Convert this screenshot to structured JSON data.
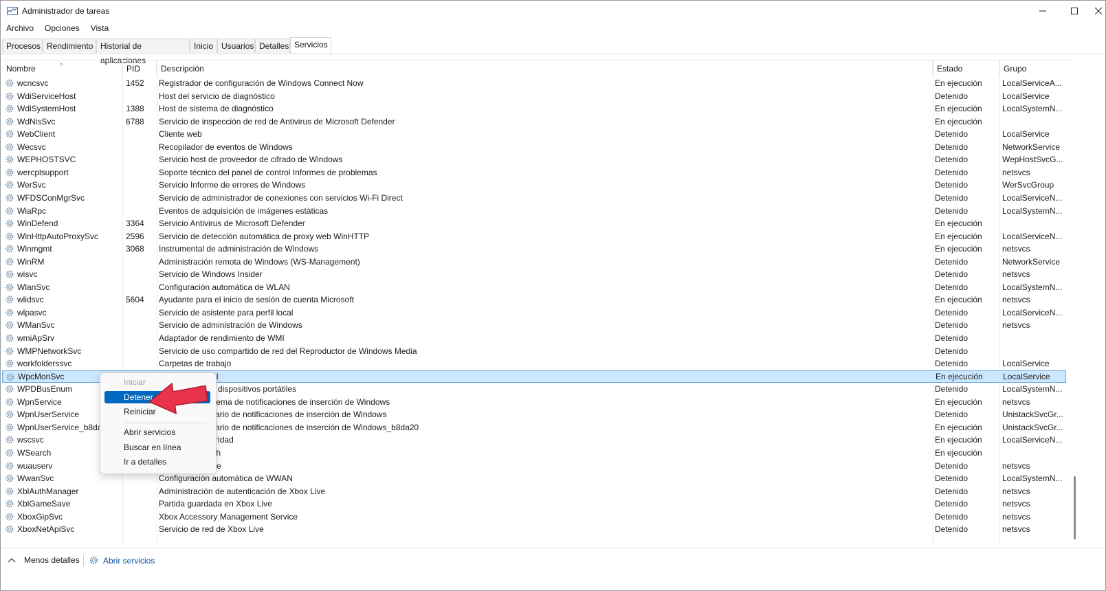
{
  "window": {
    "title": "Administrador de tareas"
  },
  "menu": [
    "Archivo",
    "Opciones",
    "Vista"
  ],
  "tabs": [
    "Procesos",
    "Rendimiento",
    "Historial de aplicaciones",
    "Inicio",
    "Usuarios",
    "Detalles",
    "Servicios"
  ],
  "active_tab": "Servicios",
  "columns": {
    "name": "Nombre",
    "pid": "PID",
    "desc": "Descripción",
    "state": "Estado",
    "group": "Grupo"
  },
  "rows": [
    [
      "wcncsvc",
      "1452",
      "Registrador de configuración de Windows Connect Now",
      "En ejecución",
      "LocalServiceA..."
    ],
    [
      "WdiServiceHost",
      "",
      "Host del servicio de diagnóstico",
      "Detenido",
      "LocalService"
    ],
    [
      "WdiSystemHost",
      "1388",
      "Host de sistema de diagnóstico",
      "En ejecución",
      "LocalSystemN..."
    ],
    [
      "WdNisSvc",
      "6788",
      "Servicio de inspección de red de Antivirus de Microsoft Defender",
      "En ejecución",
      ""
    ],
    [
      "WebClient",
      "",
      "Cliente web",
      "Detenido",
      "LocalService"
    ],
    [
      "Wecsvc",
      "",
      "Recopilador de eventos de Windows",
      "Detenido",
      "NetworkService"
    ],
    [
      "WEPHOSTSVC",
      "",
      "Servicio host de proveedor de cifrado de Windows",
      "Detenido",
      "WepHostSvcG..."
    ],
    [
      "wercplsupport",
      "",
      "Soporte técnico del panel de control Informes de problemas",
      "Detenido",
      "netsvcs"
    ],
    [
      "WerSvc",
      "",
      "Servicio Informe de errores de Windows",
      "Detenido",
      "WerSvcGroup"
    ],
    [
      "WFDSConMgrSvc",
      "",
      "Servicio de administrador de conexiones con servicios Wi-Fi Direct",
      "Detenido",
      "LocalServiceN..."
    ],
    [
      "WiaRpc",
      "",
      "Eventos de adquisición de imágenes estáticas",
      "Detenido",
      "LocalSystemN..."
    ],
    [
      "WinDefend",
      "3364",
      "Servicio Antivirus de Microsoft Defender",
      "En ejecución",
      ""
    ],
    [
      "WinHttpAutoProxySvc",
      "2596",
      "Servicio de detección automática de proxy web WinHTTP",
      "En ejecución",
      "LocalServiceN..."
    ],
    [
      "Winmgmt",
      "3068",
      "Instrumental de administración de Windows",
      "En ejecución",
      "netsvcs"
    ],
    [
      "WinRM",
      "",
      "Administración remota de Windows (WS-Management)",
      "Detenido",
      "NetworkService"
    ],
    [
      "wisvc",
      "",
      "Servicio de Windows Insider",
      "Detenido",
      "netsvcs"
    ],
    [
      "WlanSvc",
      "",
      "Configuración automática de WLAN",
      "Detenido",
      "LocalSystemN..."
    ],
    [
      "wlidsvc",
      "5604",
      "Ayudante para el inicio de sesión de cuenta Microsoft",
      "En ejecución",
      "netsvcs"
    ],
    [
      "wlpasvc",
      "",
      "Servicio de asistente para perfil local",
      "Detenido",
      "LocalServiceN..."
    ],
    [
      "WManSvc",
      "",
      "Servicio de administración de Windows",
      "Detenido",
      "netsvcs"
    ],
    [
      "wmiApSrv",
      "",
      "Adaptador de rendimiento de WMI",
      "Detenido",
      ""
    ],
    [
      "WMPNetworkSvc",
      "",
      "Servicio de uso compartido de red del Reproductor de Windows Media",
      "Detenido",
      ""
    ],
    [
      "workfolderssvc",
      "",
      "Carpetas de trabajo",
      "Detenido",
      "LocalService"
    ],
    [
      "WpcMonSvc",
      "",
      "Control parental",
      "En ejecución",
      "LocalService"
    ],
    [
      "WPDBusEnum",
      "",
      "Enumerador de dispositivos portátiles",
      "Detenido",
      "LocalSystemN..."
    ],
    [
      "WpnService",
      "",
      "Servicio del sistema de notificaciones de inserción de Windows",
      "En ejecución",
      "netsvcs"
    ],
    [
      "WpnUserService",
      "",
      "Servicio de usuario de notificaciones de inserción de Windows",
      "Detenido",
      "UnistackSvcGr..."
    ],
    [
      "WpnUserService_b8da20",
      "",
      "Servicio de usuario de notificaciones de inserción de Windows_b8da20",
      "En ejecución",
      "UnistackSvcGr..."
    ],
    [
      "wscsvc",
      "",
      "Centro de seguridad",
      "En ejecución",
      "LocalServiceN..."
    ],
    [
      "WSearch",
      "",
      "Windows Search",
      "En ejecución",
      ""
    ],
    [
      "wuauserv",
      "",
      "Windows Update",
      "Detenido",
      "netsvcs"
    ],
    [
      "WwanSvc",
      "",
      "Configuración automática de WWAN",
      "Detenido",
      "LocalSystemN..."
    ],
    [
      "XblAuthManager",
      "",
      "Administración de autenticación de Xbox Live",
      "Detenido",
      "netsvcs"
    ],
    [
      "XblGameSave",
      "",
      "Partida guardada en Xbox Live",
      "Detenido",
      "netsvcs"
    ],
    [
      "XboxGipSvc",
      "",
      "Xbox Accessory Management Service",
      "Detenido",
      "netsvcs"
    ],
    [
      "XboxNetApiSvc",
      "",
      "Servicio de red de Xbox Live",
      "Detenido",
      "netsvcs"
    ]
  ],
  "selected_row": "WpcMonSvc",
  "context_menu": {
    "items": [
      "Iniciar",
      "Detener",
      "Reiniciar",
      "Abrir servicios",
      "Buscar en línea",
      "Ir a detalles"
    ],
    "disabled": [
      "Iniciar"
    ],
    "highlighted": "Detener"
  },
  "footer": {
    "less_details": "Menos detalles",
    "open_services": "Abrir servicios"
  },
  "colors": {
    "selection": "#cce8ff",
    "menu_highlight": "#0067c0",
    "pointer_arrow": "#e8334a",
    "link": "#0050a0"
  }
}
